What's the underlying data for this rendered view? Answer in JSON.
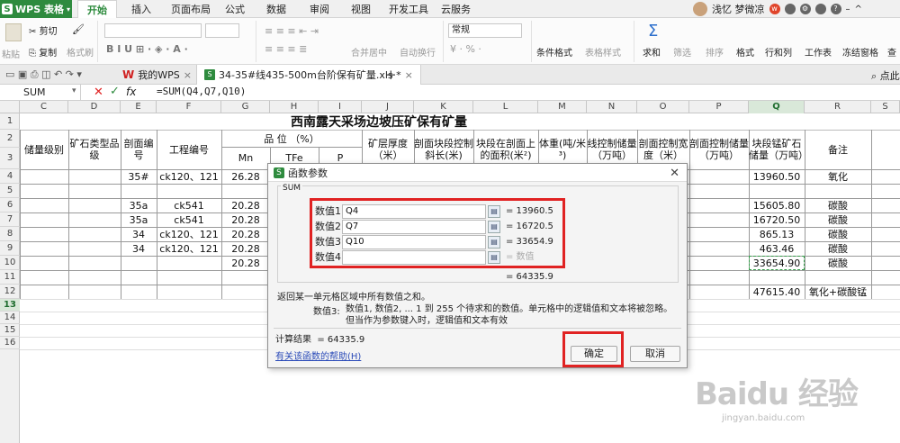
{
  "menubar": {
    "logo": "WPS 表格",
    "tabs": [
      "开始",
      "插入",
      "页面布局",
      "公式",
      "数据",
      "审阅",
      "视图",
      "开发工具",
      "云服务"
    ],
    "active_tab": "开始",
    "user": "浅忆 梦微凉"
  },
  "toolbar": {
    "paste": "粘贴",
    "cut": "剪切",
    "copy": "复制",
    "format_painter": "格式刷",
    "merge_center": "合并居中",
    "wrap": "自动换行",
    "number_format": "常规",
    "cond_format": "条件格式",
    "table_style": "表格样式",
    "sum": "求和",
    "filter": "筛选",
    "sort": "排序",
    "format": "格式",
    "rows_cols": "行和列",
    "worksheet": "工作表",
    "freeze": "冻结窗格",
    "find": "查"
  },
  "doctabs": {
    "my_wps": "我的WPS",
    "file": "34-35#线435-500m台阶保有矿量.xls *",
    "add": "+",
    "right": "点此"
  },
  "formula_bar": {
    "name_box": "SUM",
    "fx": "fx",
    "formula": "=SUM(Q4,Q7,Q10)"
  },
  "sheet": {
    "columns": [
      "C",
      "D",
      "E",
      "F",
      "G",
      "H",
      "I",
      "J",
      "K",
      "L",
      "M",
      "N",
      "O",
      "P",
      "Q",
      "R",
      "S"
    ],
    "rows": [
      "1",
      "2",
      "3",
      "4",
      "5",
      "6",
      "7",
      "8",
      "9",
      "10",
      "11",
      "12",
      "13",
      "14",
      "15",
      "16"
    ],
    "title": "西南露天采场边坡压矿保有矿量",
    "headers": {
      "reserve_level": "储量级别",
      "ore_type": "矿石类型品级",
      "section_no": "剖面编号",
      "project_no": "工程编号",
      "grade": "品 位 （%）",
      "mn": "Mn",
      "tfe": "TFe",
      "p": "P",
      "thickness": "矿层厚度（米）",
      "slope": "剖面块段控制斜长(米)",
      "area": "块段在剖面上的面积(米²)",
      "density": "体重(吨/米³)",
      "line_reserve": "线控制储量（万吨）",
      "width": "剖面控制宽度（米）",
      "section_reserve": "剖面控制储量（万吨）",
      "block_reserve": "块段锰矿石储量（万吨）",
      "remark": "备注"
    },
    "data": [
      {
        "row": "4",
        "section": "35#",
        "project": "ck120、121",
        "mn": "26.28",
        "q": "13960.50",
        "remark": "氧化"
      },
      {
        "row": "6",
        "section": "35a",
        "project": "ck541",
        "mn": "20.28",
        "q": "15605.80",
        "remark": "碳酸"
      },
      {
        "row": "7",
        "section": "35a",
        "project": "ck541",
        "mn": "20.28",
        "q": "16720.50",
        "remark": "碳酸"
      },
      {
        "row": "8",
        "section": "34",
        "project": "ck120、121",
        "mn": "20.28",
        "q": "865.13",
        "remark": "碳酸"
      },
      {
        "row": "9",
        "section": "34",
        "project": "ck120、121",
        "mn": "20.28",
        "q": "463.46",
        "remark": "碳酸"
      },
      {
        "row": "10",
        "section": "",
        "project": "",
        "mn": "20.28",
        "q": "33654.90",
        "remark": "碳酸"
      },
      {
        "row": "12",
        "section": "",
        "project": "",
        "mn": "",
        "q": "47615.40",
        "remark": "氧化+碳酸锰"
      }
    ]
  },
  "dialog": {
    "title": "函数参数",
    "function": "SUM",
    "args": [
      {
        "label": "数值1",
        "value": "Q4",
        "result": "= 13960.5"
      },
      {
        "label": "数值2",
        "value": "Q7",
        "result": "= 16720.5"
      },
      {
        "label": "数值3",
        "value": "Q10",
        "result": "= 33654.9"
      },
      {
        "label": "数值4",
        "value": "",
        "result": "= 数值"
      }
    ],
    "total": "= 64335.9",
    "description": "返回某一单元格区域中所有数值之和。",
    "arg_label": "数值3:",
    "arg_desc": "数值1, 数值2, ... 1 到 255 个待求和的数值。单元格中的逻辑值和文本将被忽略。但当作为参数键入时，逻辑值和文本有效",
    "calc_label": "计算结果",
    "calc_value": "= 64335.9",
    "help": "有关该函数的帮助(H)",
    "ok": "确定",
    "cancel": "取消"
  },
  "watermark": {
    "brand": "Baidu 经验",
    "url": "jingyan.baidu.com"
  }
}
